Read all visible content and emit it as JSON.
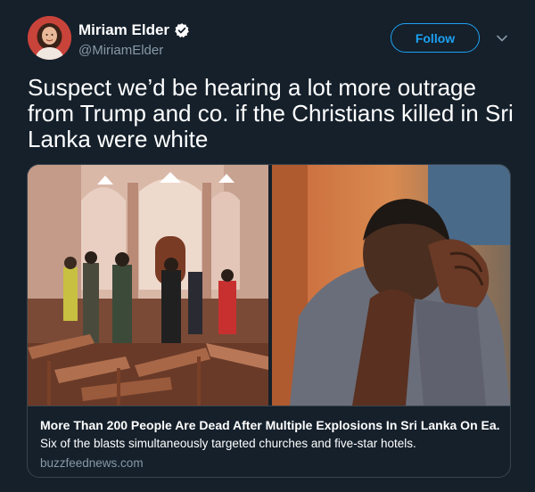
{
  "author": {
    "name": "Miriam Elder",
    "handle": "@MiriamElder",
    "verified": true,
    "avatar_icon": "profile-photo"
  },
  "follow_button": {
    "label": "Follow"
  },
  "menu_icon": "chevron-down-icon",
  "tweet": {
    "text": "Suspect we’d be hearing a lot more outrage from Trump and co. if the Christians killed in Sri Lanka were white"
  },
  "card": {
    "title": "More Than 200 People Are Dead After Multiple Explosions In Sri Lanka On Ea...",
    "description": "Six of the blasts simultaneously targeted churches and five-star hotels.",
    "domain": "buzzfeednews.com"
  },
  "colors": {
    "background": "#15202b",
    "accent": "#1da1f2",
    "secondary_text": "#8899a6",
    "border": "#38444d"
  }
}
